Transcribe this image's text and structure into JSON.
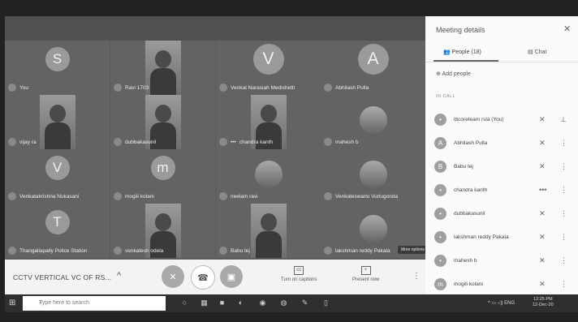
{
  "tiles": [
    {
      "name": "You",
      "type": "avatar",
      "letter": "S"
    },
    {
      "name": "Ravi 1703",
      "type": "video"
    },
    {
      "name": "Venkat Narasiah Medishetti",
      "type": "avatar",
      "letter": "V"
    },
    {
      "name": "Abhilash Pulla",
      "type": "avatar",
      "letter": "A"
    },
    {
      "name": "vijay ra",
      "type": "video"
    },
    {
      "name": "dubbakasunil",
      "type": "video"
    },
    {
      "name": "chandra kanth",
      "type": "video",
      "indicator": "•••"
    },
    {
      "name": "mahesh b",
      "type": "rvideo"
    },
    {
      "name": "Venkatakrishna Nukasani",
      "type": "avatar",
      "letter": "V"
    },
    {
      "name": "mogili kolani",
      "type": "avatar",
      "letter": "m"
    },
    {
      "name": "neelam ravi",
      "type": "rvideo"
    },
    {
      "name": "Venkateswarlu Vurlugonda",
      "type": "rvideo"
    },
    {
      "name": "Thangallapally Police Station",
      "type": "avatar",
      "letter": "T"
    },
    {
      "name": "venkatesh odela",
      "type": "video"
    },
    {
      "name": "Babu tej",
      "type": "video"
    },
    {
      "name": "lakshman reddy Pakala",
      "type": "rvideo"
    }
  ],
  "controls": {
    "meeting_title": "CCTV VERTICAL VC OF RS...",
    "captions_label": "Turn on captions",
    "present_label": "Present now",
    "tooltip": "More options"
  },
  "panel": {
    "title": "Meeting details",
    "people_tab": "People (18)",
    "chat_tab": "Chat",
    "add_people": "Add people",
    "in_call_label": "IN CALL",
    "people": [
      {
        "name": "ittcoreteam rsla (You)",
        "avatar": "•"
      },
      {
        "name": "Abhilash Pulla",
        "avatar": "A"
      },
      {
        "name": "Babu tej",
        "avatar": "B"
      },
      {
        "name": "chandra kanth",
        "avatar": "•"
      },
      {
        "name": "dubbakasunil",
        "avatar": "•"
      },
      {
        "name": "lakshman reddy Pakala",
        "avatar": "•"
      },
      {
        "name": "mahesh b",
        "avatar": "•"
      },
      {
        "name": "mogili kolani",
        "avatar": "m"
      }
    ]
  },
  "taskbar": {
    "search_placeholder": "Type here to search",
    "lang": "ENG",
    "time": "12:25 PM",
    "date": "12-Dec-20"
  }
}
